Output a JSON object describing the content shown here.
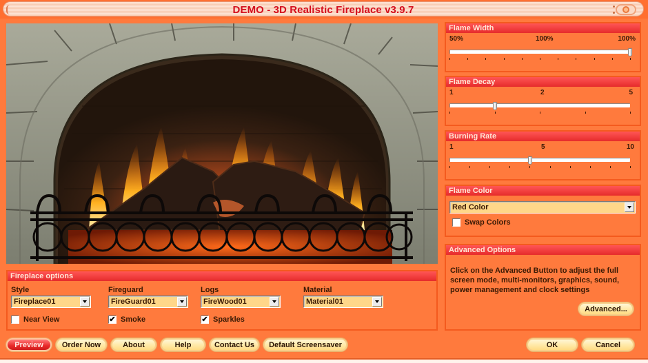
{
  "window": {
    "title": "DEMO - 3D Realistic Fireplace v3.9.7",
    "title_color": "#d40f1f",
    "title_button_icon": "window-orb-icon"
  },
  "preview": {
    "description": "Animated stone-arch fireplace with burning logs behind a wrought-iron fireguard",
    "icon": "fireplace-preview-image"
  },
  "flame_width": {
    "header": "Flame Width",
    "labels": [
      "50%",
      "100%",
      "100%"
    ],
    "min_label": "50%",
    "mid_label": "100%",
    "max_label": "100%",
    "tick_count": 11,
    "value_fraction": 1.0
  },
  "flame_decay": {
    "header": "Flame Decay",
    "min_label": "1",
    "mid_label": "2",
    "max_label": "5",
    "tick_count": 5,
    "value_fraction": 0.25
  },
  "burning_rate": {
    "header": "Burning Rate",
    "min_label": "1",
    "mid_label": "5",
    "max_label": "10",
    "tick_count": 10,
    "value": 5,
    "value_fraction": 0.444
  },
  "flame_color": {
    "header": "Flame Color",
    "selected": "Red Color",
    "swap_colors_label": "Swap Colors",
    "swap_colors_checked": false
  },
  "advanced_options": {
    "header": "Advanced Options",
    "description": "Click on the Advanced Button to adjust the full screen mode, multi-monitors, graphics, sound, power management and clock settings",
    "button_label": "Advanced..."
  },
  "fireplace_options": {
    "header": "Fireplace options",
    "fields": [
      {
        "label": "Style",
        "value": "Fireplace01"
      },
      {
        "label": "Fireguard",
        "value": "FireGuard01"
      },
      {
        "label": "Logs",
        "value": "FireWood01"
      },
      {
        "label": "Material",
        "value": "Material01"
      }
    ],
    "checkboxes": [
      {
        "label": "Near View",
        "checked": false,
        "mark": ""
      },
      {
        "label": "Smoke",
        "checked": true,
        "mark": "✔"
      },
      {
        "label": "Sparkles",
        "checked": true,
        "mark": "✔"
      }
    ]
  },
  "footer": {
    "buttons": [
      {
        "label": "Preview",
        "style": "red"
      },
      {
        "label": "Order Now"
      },
      {
        "label": "About"
      },
      {
        "label": "Help"
      },
      {
        "label": "Contact Us"
      },
      {
        "label": "Default Screensaver"
      }
    ],
    "ok_label": "OK",
    "cancel_label": "Cancel"
  },
  "colors": {
    "background": "#ff7a3d",
    "panel_border": "#f45a1e",
    "header_red": "#e62b2b",
    "dropdown_fill": "#ffd789",
    "button_cream": "#ffe8a6"
  }
}
